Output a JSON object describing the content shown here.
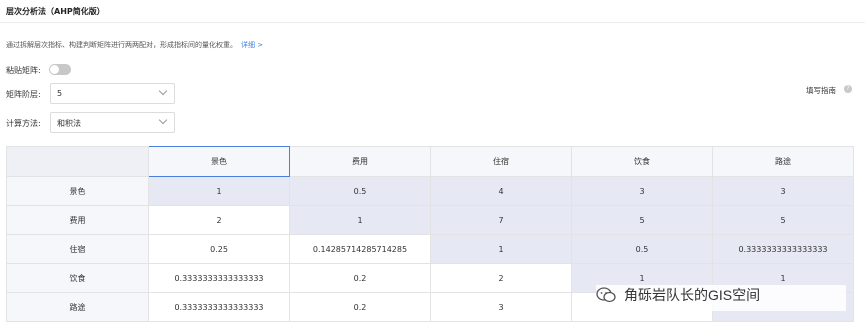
{
  "header": {
    "title": "层次分析法（AHP简化版）"
  },
  "description": {
    "text": "通过拆解层次指标、构建判断矩阵进行两两配对，形成指标间的量化权重。",
    "more_link": "详细 >"
  },
  "controls": {
    "paste_label": "粘贴矩阵:",
    "paste_enabled": false,
    "order_label": "矩阵阶层:",
    "order_value": "5",
    "method_label": "计算方法:",
    "method_value": "和积法",
    "guide_label": "填写指南"
  },
  "matrix": {
    "columns": [
      "景色",
      "费用",
      "住宿",
      "饮食",
      "路途"
    ],
    "rows": [
      {
        "label": "景色",
        "values": [
          "1",
          "0.5",
          "4",
          "3",
          "3"
        ]
      },
      {
        "label": "费用",
        "values": [
          "2",
          "1",
          "7",
          "5",
          "5"
        ]
      },
      {
        "label": "住宿",
        "values": [
          "0.25",
          "0.14285714285714285",
          "1",
          "0.5",
          "0.3333333333333333"
        ]
      },
      {
        "label": "饮食",
        "values": [
          "0.3333333333333333",
          "0.2",
          "2",
          "1",
          "1"
        ]
      },
      {
        "label": "路途",
        "values": [
          "0.3333333333333333",
          "0.2",
          "3",
          "",
          ""
        ]
      }
    ]
  },
  "watermark": {
    "text": "角砾岩队长的GIS空间"
  }
}
